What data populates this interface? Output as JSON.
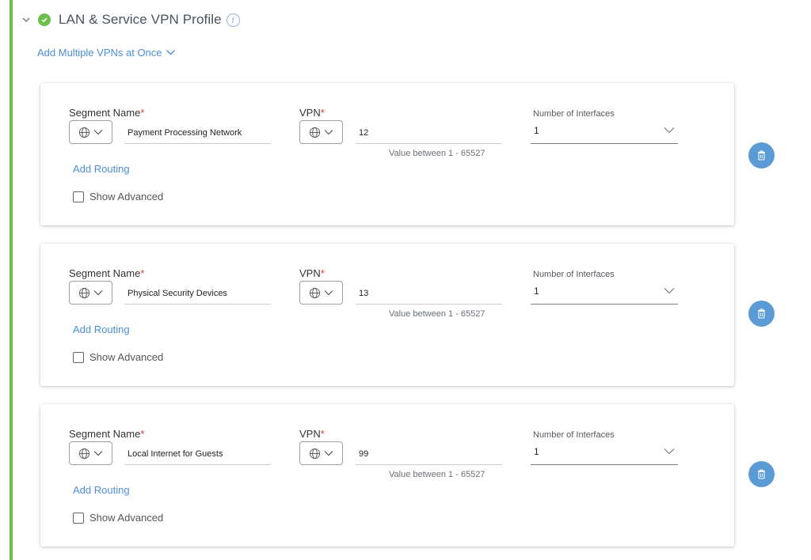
{
  "section": {
    "title": "LAN & Service VPN Profile",
    "add_multiple_label": "Add Multiple VPNs at Once",
    "accent_color": "#6abf4b",
    "link_color": "#4a8fd8"
  },
  "labels": {
    "segment_name": "Segment Name",
    "vpn": "VPN",
    "required_marker": "*",
    "number_of_interfaces": "Number of Interfaces",
    "vpn_hint": "Value between 1 - 65527",
    "add_routing": "Add Routing",
    "show_advanced": "Show Advanced"
  },
  "segments": [
    {
      "name": "Payment Processing Network",
      "vpn": "12",
      "interfaces": "1"
    },
    {
      "name": "Physical Security Devices",
      "vpn": "13",
      "interfaces": "1"
    },
    {
      "name": "Local Internet for Guests",
      "vpn": "99",
      "interfaces": "1"
    }
  ],
  "icons": {
    "collapse": "chevron-down-icon",
    "status": "check-circle-icon",
    "info": "info-icon",
    "globe": "globe-icon",
    "dropdown": "chevron-down-icon",
    "delete": "trash-icon"
  }
}
